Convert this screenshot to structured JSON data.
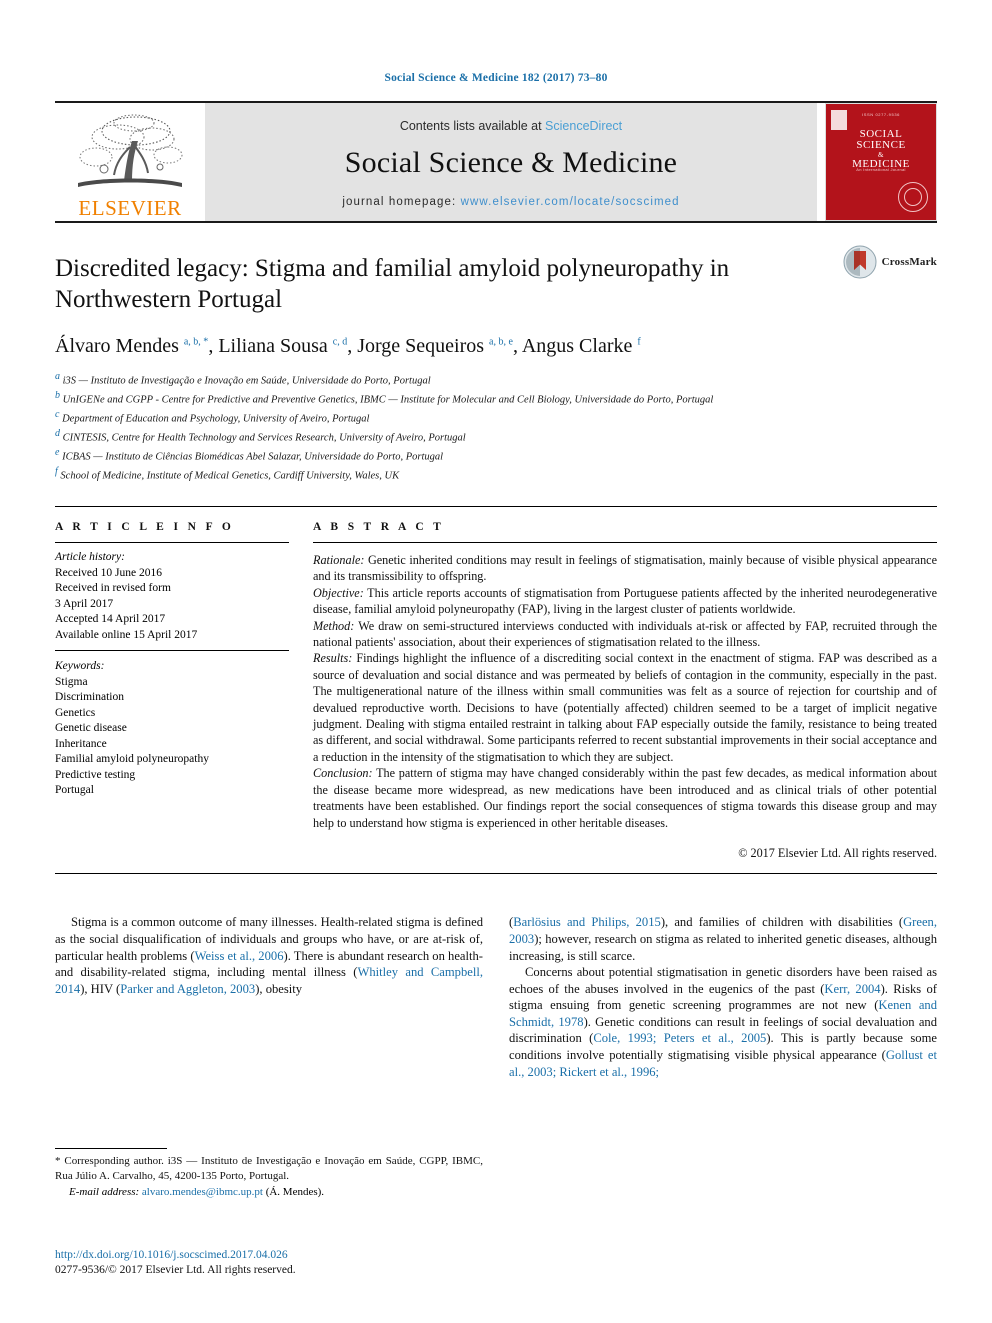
{
  "running_head": "Social Science & Medicine 182 (2017) 73–80",
  "masthead": {
    "publisher_name": "ELSEVIER",
    "contents_prefix": "Contents lists available at ",
    "contents_link": "ScienceDirect",
    "journal_title": "Social Science & Medicine",
    "homepage_prefix": "journal homepage: ",
    "homepage_url": "www.elsevier.com/locate/socscimed",
    "cover": {
      "top_label": "ISSN 0277-9536",
      "line1": "SOCIAL",
      "line2": "SCIENCE",
      "amp": "&",
      "line3": "MEDICINE",
      "subtitle": "An International Journal"
    },
    "link_color": "#4a9fd4",
    "band_color": "#e3e3e3",
    "cover_color": "#b3131b",
    "elsevier_orange": "#f08000"
  },
  "article": {
    "title": "Discredited legacy: Stigma and familial amyloid polyneuropathy in Northwestern Portugal",
    "crossmark_label": "CrossMark",
    "authors_html": "Álvaro Mendes <sup>a, b, *</sup>, Liliana Sousa <sup>c, d</sup>, Jorge Sequeiros <sup>a, b, e</sup>, Angus Clarke <sup>f</sup>",
    "affiliations": [
      {
        "marker": "a",
        "text": "i3S — Instituto de Investigação e Inovação em Saúde, Universidade do Porto, Portugal"
      },
      {
        "marker": "b",
        "text": "UnIGENe and CGPP - Centre for Predictive and Preventive Genetics, IBMC — Institute for Molecular and Cell Biology, Universidade do Porto, Portugal"
      },
      {
        "marker": "c",
        "text": "Department of Education and Psychology, University of Aveiro, Portugal"
      },
      {
        "marker": "d",
        "text": "CINTESIS, Centre for Health Technology and Services Research, University of Aveiro, Portugal"
      },
      {
        "marker": "e",
        "text": "ICBAS — Instituto de Ciências Biomédicas Abel Salazar, Universidade do Porto, Portugal"
      },
      {
        "marker": "f",
        "text": "School of Medicine, Institute of Medical Genetics, Cardiff University, Wales, UK"
      }
    ]
  },
  "article_info": {
    "heading": "A R T I C L E   I N F O",
    "history_label": "Article history:",
    "history": [
      "Received 10 June 2016",
      "Received in revised form",
      "3 April 2017",
      "Accepted 14 April 2017",
      "Available online 15 April 2017"
    ],
    "keywords_label": "Keywords:",
    "keywords": [
      "Stigma",
      "Discrimination",
      "Genetics",
      "Genetic disease",
      "Inheritance",
      "Familial amyloid polyneuropathy",
      "Predictive testing",
      "Portugal"
    ]
  },
  "abstract": {
    "heading": "A B S T R A C T",
    "sections": [
      {
        "label": "Rationale:",
        "text": " Genetic inherited conditions may result in feelings of stigmatisation, mainly because of visible physical appearance and its transmissibility to offspring."
      },
      {
        "label": "Objective:",
        "text": " This article reports accounts of stigmatisation from Portuguese patients affected by the inherited neurodegenerative disease, familial amyloid polyneuropathy (FAP), living in the largest cluster of patients worldwide."
      },
      {
        "label": "Method:",
        "text": " We draw on semi-structured interviews conducted with individuals at-risk or affected by FAP, recruited through the national patients' association, about their experiences of stigmatisation related to the illness."
      },
      {
        "label": "Results:",
        "text": " Findings highlight the influence of a discrediting social context in the enactment of stigma. FAP was described as a source of devaluation and social distance and was permeated by beliefs of contagion in the community, especially in the past. The multigenerational nature of the illness within small communities was felt as a source of rejection for courtship and of devalued reproductive worth. Decisions to have (potentially affected) children seemed to be a target of implicit negative judgment. Dealing with stigma entailed restraint in talking about FAP especially outside the family, resistance to being treated as different, and social withdrawal. Some participants referred to recent substantial improvements in their social acceptance and a reduction in the intensity of the stigmatisation to which they are subject."
      },
      {
        "label": "Conclusion:",
        "text": " The pattern of stigma may have changed considerably within the past few decades, as medical information about the disease became more widespread, as new medications have been introduced and as clinical trials of other potential treatments have been established. Our findings report the social consequences of stigma towards this disease group and may help to understand how stigma is experienced in other heritable diseases."
      }
    ],
    "copyright": "© 2017 Elsevier Ltd. All rights reserved."
  },
  "body": {
    "left_column": [
      {
        "indent": true,
        "parts": [
          {
            "type": "text",
            "value": "Stigma is a common outcome of many illnesses. Health-related stigma is defined as the social disqualification of individuals and groups who have, or are at-risk of, particular health problems ("
          },
          {
            "type": "cit",
            "value": "Weiss et al., 2006"
          },
          {
            "type": "text",
            "value": "). There is abundant research on health- and disability-related stigma, including mental illness ("
          },
          {
            "type": "cit",
            "value": "Whitley and Campbell, 2014"
          },
          {
            "type": "text",
            "value": "), HIV ("
          },
          {
            "type": "cit",
            "value": "Parker and Aggleton, 2003"
          },
          {
            "type": "text",
            "value": "), obesity"
          }
        ]
      }
    ],
    "right_column": [
      {
        "indent": false,
        "parts": [
          {
            "type": "text",
            "value": "("
          },
          {
            "type": "cit",
            "value": "Barlösius and Philips, 2015"
          },
          {
            "type": "text",
            "value": "), and families of children with disabilities ("
          },
          {
            "type": "cit",
            "value": "Green, 2003"
          },
          {
            "type": "text",
            "value": "); however, research on stigma as related to inherited genetic diseases, although increasing, is still scarce."
          }
        ]
      },
      {
        "indent": true,
        "parts": [
          {
            "type": "text",
            "value": "Concerns about potential stigmatisation in genetic disorders have been raised as echoes of the abuses involved in the eugenics of the past ("
          },
          {
            "type": "cit",
            "value": "Kerr, 2004"
          },
          {
            "type": "text",
            "value": "). Risks of stigma ensuing from genetic screening programmes are not new ("
          },
          {
            "type": "cit",
            "value": "Kenen and Schmidt, 1978"
          },
          {
            "type": "text",
            "value": "). Genetic conditions can result in feelings of social devaluation and discrimination ("
          },
          {
            "type": "cit",
            "value": "Cole, 1993; Peters et al., 2005"
          },
          {
            "type": "text",
            "value": "). This is partly because some conditions involve potentially stigmatising visible physical appearance ("
          },
          {
            "type": "cit",
            "value": "Gollust et al., 2003; Rickert et al., 1996;"
          }
        ]
      }
    ]
  },
  "footnotes": {
    "corresponding_marker": "*",
    "corresponding_text": " Corresponding author. i3S — Instituto de Investigação e Inovação em Saúde, CGPP, IBMC, Rua Júlio A. Carvalho, 45, 4200-135 Porto, Portugal.",
    "email_label": "E-mail address:",
    "email": "alvaro.mendes@ibmc.up.pt",
    "email_suffix": " (Á. Mendes)."
  },
  "footer": {
    "doi": "http://dx.doi.org/10.1016/j.socscimed.2017.04.026",
    "issn_line": "0277-9536/© 2017 Elsevier Ltd. All rights reserved."
  }
}
